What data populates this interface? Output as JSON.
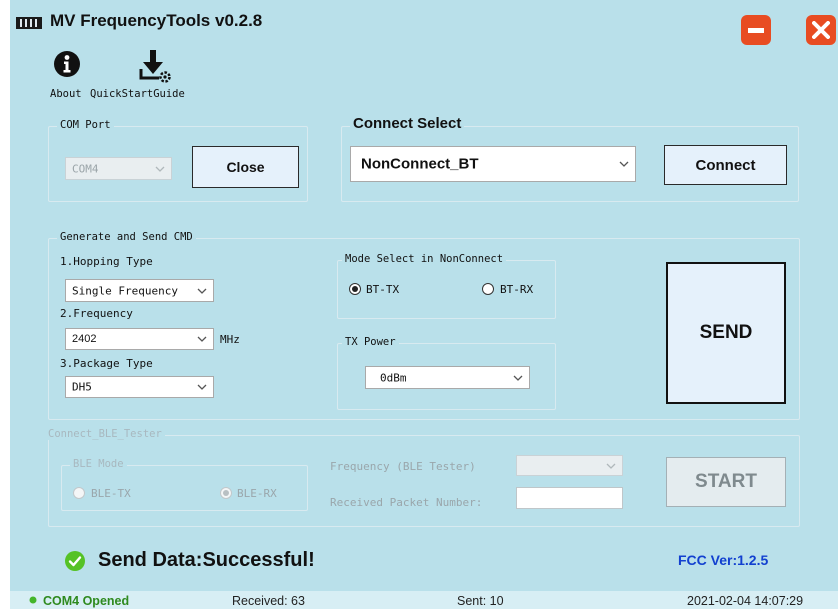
{
  "app": {
    "title": "MV FrequencyTools v0.2.8"
  },
  "toolbar": {
    "about_label": "About",
    "guide_label": "QuickStartGuide"
  },
  "com_port": {
    "group_title": "COM Port",
    "port_value": "COM4",
    "close_label": "Close"
  },
  "connect_select": {
    "title": "Connect Select",
    "value": "NonConnect_BT",
    "connect_label": "Connect"
  },
  "generate": {
    "group_title": "Generate and Send CMD",
    "hopping_label": "1.Hopping Type",
    "hopping_value": "Single Frequency",
    "frequency_label": "2.Frequency",
    "frequency_value": "2402",
    "frequency_unit": "MHz",
    "package_label": "3.Package Type",
    "package_value": "DH5",
    "mode_group_title": "Mode Select in NonConnect",
    "mode_options": [
      {
        "label": "BT-TX",
        "selected": true
      },
      {
        "label": "BT-RX",
        "selected": false
      }
    ],
    "txpower_group_title": "TX Power",
    "txpower_value": "0dBm",
    "send_label": "SEND"
  },
  "ble": {
    "group_title": "Connect_BLE_Tester",
    "mode_group_title": "BLE Mode",
    "mode_options": [
      {
        "label": "BLE-TX",
        "selected": false
      },
      {
        "label": "BLE-RX",
        "selected": true
      }
    ],
    "frequency_label": "Frequency (BLE Tester)",
    "frequency_value": "",
    "received_label": "Received Packet Number:",
    "received_value": "",
    "start_label": "START"
  },
  "status": {
    "message": "Send Data:Successful!",
    "fcc_version": "FCC Ver:1.2.5",
    "success_color": "#55c226"
  },
  "statusbar": {
    "port_status": "COM4 Opened",
    "received": "Received: 63",
    "sent": "Sent: 10",
    "datetime": "2021-02-04 14:07:29"
  },
  "colors": {
    "background": "#b9e0ea",
    "window_button": "#e84c22",
    "fcc_text": "#1240d0"
  }
}
